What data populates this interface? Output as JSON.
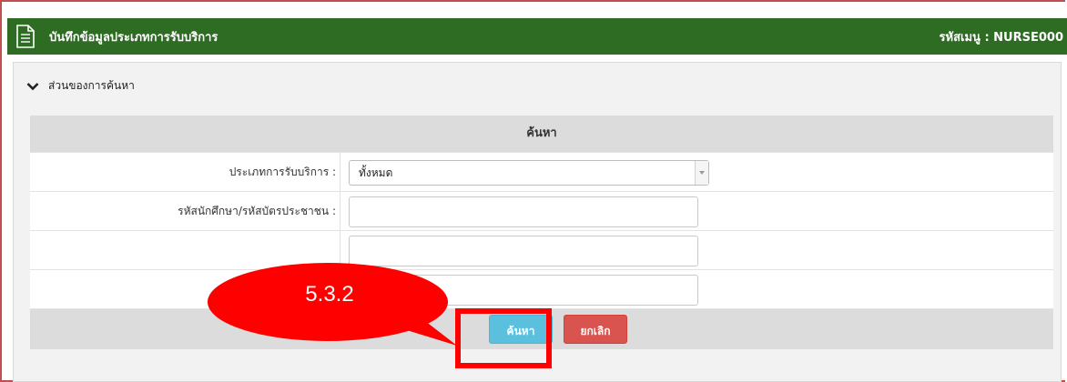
{
  "window": {
    "title": "บันทึกข้อมูลประเภทการรับบริการ",
    "menu_code": "รหัสเมนู : NURSE000"
  },
  "section": {
    "label": "ส่วนของการค้นหา"
  },
  "form": {
    "header": "ค้นหา",
    "service_type_label": "ประเภทการรับบริการ :",
    "service_type_value": "ทั้งหมด",
    "student_id_label": "รหัสนักศึกษา/รหัสบัตรประชาชน :",
    "student_id_value": "",
    "row3_label": "",
    "row3_value": "",
    "row4_label": "",
    "row4_value": ""
  },
  "buttons": {
    "search_label": "ค้นหา",
    "cancel_label": "ยกเลิก"
  },
  "annotation": {
    "callout_text": "5.3.2",
    "callout_color": "#ff0000",
    "highlight_color": "#ff0000"
  },
  "colors": {
    "titlebar": "#2e6b23",
    "search_button": "#5bc0de",
    "cancel_button": "#d9534f"
  }
}
